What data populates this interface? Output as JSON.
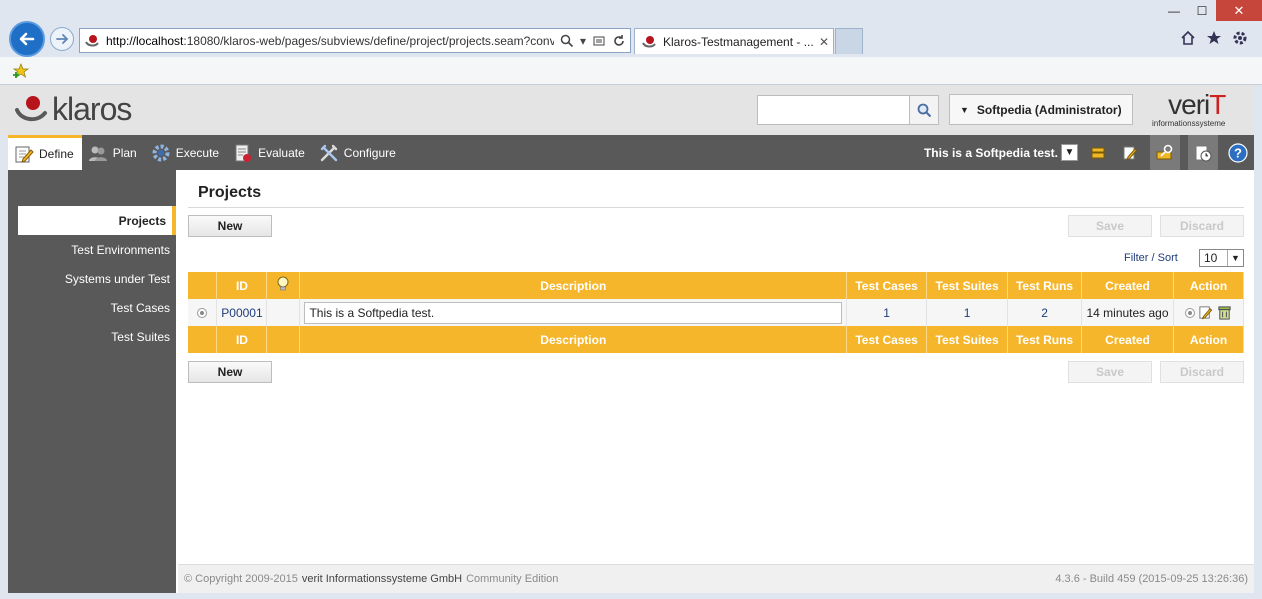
{
  "browser": {
    "url_host": "http://localhost",
    "url_rest": ":18080/klaros-web/pages/subviews/define/project/projects.seam?conv",
    "tab_title": "Klaros-Testmanagement - ...",
    "tab_close": "✕",
    "window_buttons": {
      "minimize": "—",
      "maximize": "☐",
      "close": "✕"
    }
  },
  "header": {
    "logo_text": "klaros",
    "search_placeholder": "",
    "user_label": "Softpedia (Administrator)",
    "vendor_word_a": "veri",
    "vendor_word_b": "T",
    "vendor_sub": "informationssysteme"
  },
  "nav": {
    "items": [
      {
        "label": "Define"
      },
      {
        "label": "Plan"
      },
      {
        "label": "Execute"
      },
      {
        "label": "Evaluate"
      },
      {
        "label": "Configure"
      }
    ],
    "active_project": "This is a Softpedia test."
  },
  "sidebar": {
    "items": [
      {
        "label": "Projects"
      },
      {
        "label": "Test Environments"
      },
      {
        "label": "Systems under Test"
      },
      {
        "label": "Test Cases"
      },
      {
        "label": "Test Suites"
      }
    ]
  },
  "content": {
    "title": "Projects",
    "new_label": "New",
    "save_label": "Save",
    "discard_label": "Discard",
    "filter_sort": "Filter / Sort",
    "page_size": "10",
    "columns": [
      "ID",
      "Description",
      "Test Cases",
      "Test Suites",
      "Test Runs",
      "Created",
      "Action"
    ],
    "rows": [
      {
        "id": "P00001",
        "description": "This is a Softpedia test.",
        "test_cases": "1",
        "test_suites": "1",
        "test_runs": "2",
        "created": "14 minutes ago"
      }
    ]
  },
  "footer": {
    "copyright": "© Copyright 2009-2015",
    "org": "verit Informationssysteme GmbH",
    "edition": "Community Edition",
    "build": "4.3.6 - Build 459 (2015-09-25 13:26:36)"
  },
  "colors": {
    "accent": "#f5b62c",
    "nav_bg": "#595959",
    "link": "#1e3d7a",
    "browser_blue": "#1e6fc5"
  }
}
